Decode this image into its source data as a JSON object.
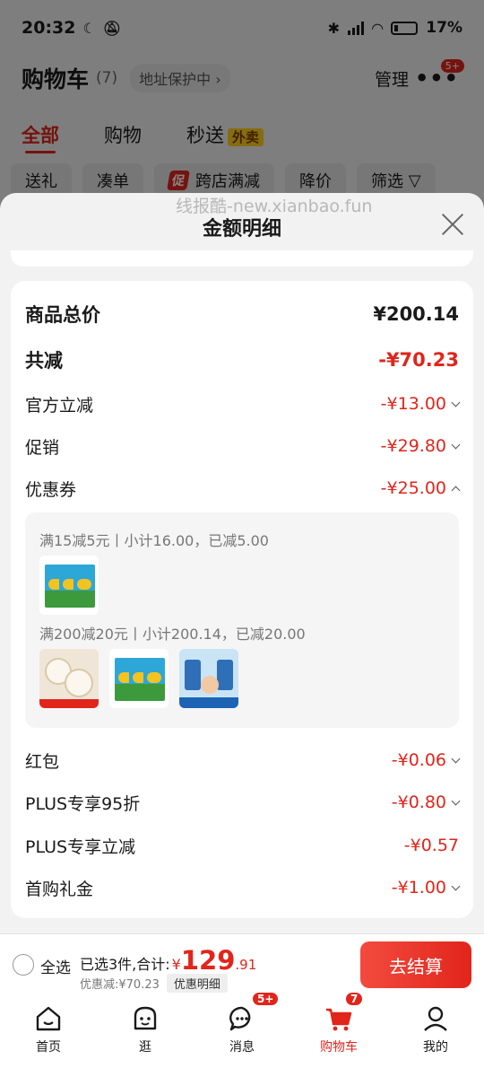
{
  "status_bar": {
    "time": "20:32",
    "battery": "17%"
  },
  "header": {
    "title": "购物车",
    "count": "(7)",
    "address": "地址保护中",
    "manage": "管理",
    "more_badge": "5+"
  },
  "tabs": [
    {
      "label": "全部"
    },
    {
      "label": "购物"
    },
    {
      "label": "秒送",
      "tag": "外卖"
    }
  ],
  "filters": [
    {
      "label": "送礼"
    },
    {
      "label": "凑单"
    },
    {
      "label": "跨店满减",
      "tag": "促"
    },
    {
      "label": "降价"
    },
    {
      "label": "筛选"
    }
  ],
  "watermark": "线报酷-new.xianbao.fun",
  "sheet": {
    "title": "金额明细",
    "rows": [
      {
        "label": "商品总价",
        "amount": "¥200.14"
      },
      {
        "label": "共减",
        "amount": "-¥70.23"
      },
      {
        "label": "官方立减",
        "amount": "-¥13.00"
      },
      {
        "label": "促销",
        "amount": "-¥29.80"
      },
      {
        "label": "优惠券",
        "amount": "-¥25.00"
      },
      {
        "label": "红包",
        "amount": "-¥0.06"
      },
      {
        "label": "PLUS专享95折",
        "amount": "-¥0.80"
      },
      {
        "label": "PLUS专享立减",
        "amount": "-¥0.57"
      },
      {
        "label": "首购礼金",
        "amount": "-¥1.00"
      }
    ],
    "coupon_groups": [
      {
        "text": "满15减5元丨小计16.00，已减5.00"
      },
      {
        "text": "满200减20元丨小计200.14，已减20.00"
      }
    ]
  },
  "checkout": {
    "select_all": "全选",
    "selected_text": "已选3件,合计:",
    "price_symbol": "¥",
    "price_int": "129",
    "price_dec": ".91",
    "discount_text": "优惠减:¥70.23",
    "detail_button": "优惠明细",
    "checkout_button": "去结算"
  },
  "tabbar": [
    {
      "label": "首页"
    },
    {
      "label": "逛"
    },
    {
      "label": "消息",
      "badge": "5+"
    },
    {
      "label": "购物车",
      "badge": "7"
    },
    {
      "label": "我的"
    }
  ],
  "colors": {
    "accent": "#e1251b",
    "sheet_bg": "#f2f2f2"
  }
}
